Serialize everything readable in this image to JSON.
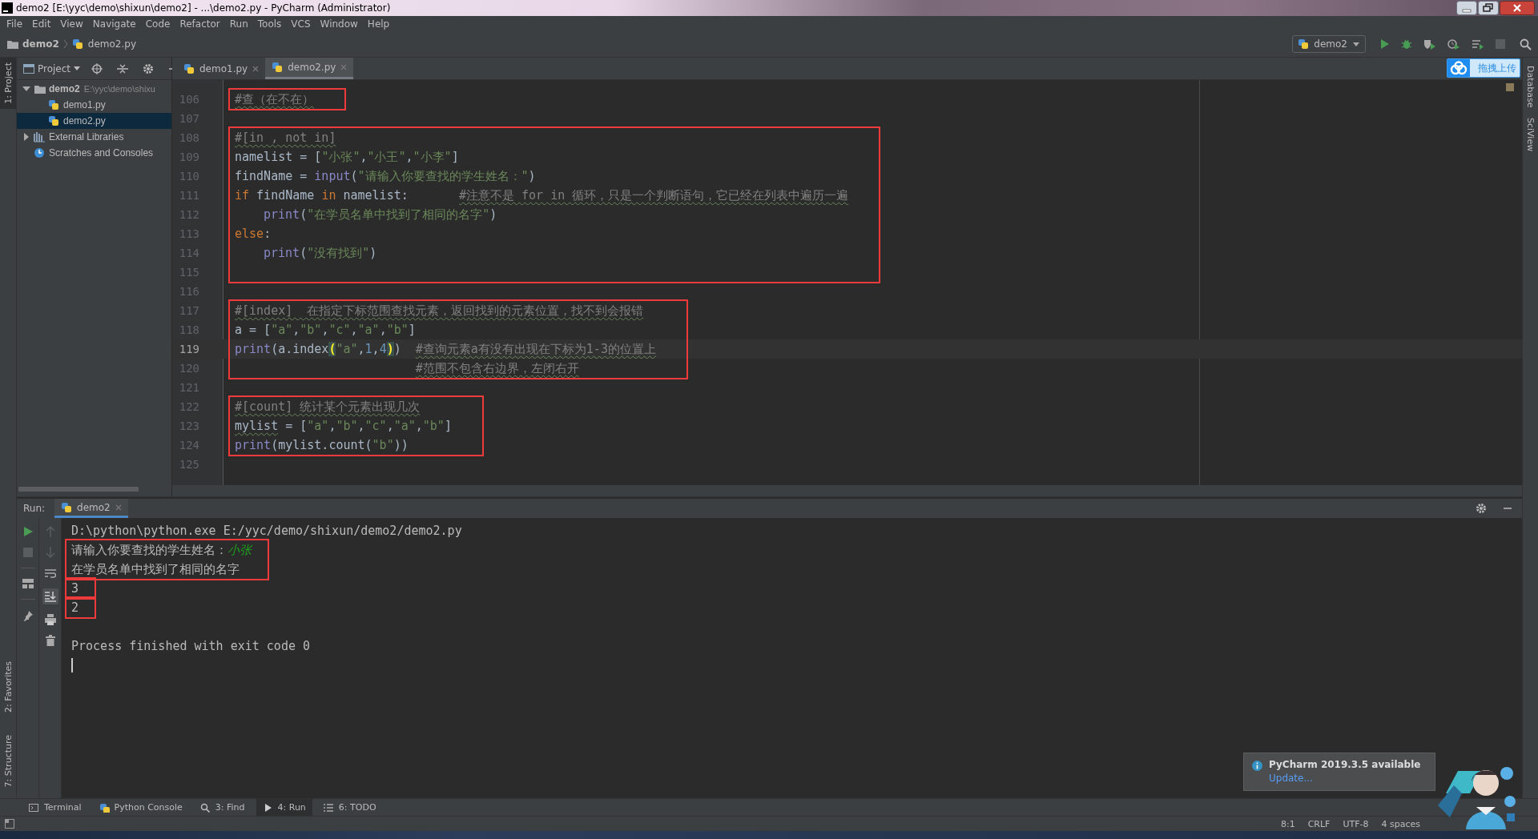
{
  "window": {
    "title": "demo2 [E:\\yyc\\demo\\shixun\\demo2] - ...\\demo2.py - PyCharm (Administrator)"
  },
  "menu": [
    "File",
    "Edit",
    "View",
    "Navigate",
    "Code",
    "Refactor",
    "Run",
    "Tools",
    "VCS",
    "Window",
    "Help"
  ],
  "breadcrumb": [
    "demo2",
    "demo2.py"
  ],
  "run_config": {
    "label": "demo2"
  },
  "upload_widget": {
    "label": "拖拽上传"
  },
  "left_stripe": {
    "top": [
      {
        "label": "1: Project",
        "selected": true
      }
    ],
    "bottom": [
      {
        "label": "2: Favorites",
        "selected": false
      },
      {
        "label": "7: Structure",
        "selected": false
      }
    ]
  },
  "right_stripe": [
    {
      "label": "Database"
    },
    {
      "label": "SciView"
    }
  ],
  "project_panel": {
    "title": "Project",
    "tree": [
      {
        "label": "demo2",
        "path": "E:\\yyc\\demo\\shixu",
        "kind": "folder",
        "expanded": true,
        "selected": false,
        "children": [
          {
            "label": "demo1.py",
            "kind": "python",
            "selected": false
          },
          {
            "label": "demo2.py",
            "kind": "python",
            "selected": true
          }
        ]
      },
      {
        "label": "External Libraries",
        "kind": "libraries",
        "expanded": false,
        "selected": false
      },
      {
        "label": "Scratches and Consoles",
        "kind": "scratches",
        "selected": false
      }
    ]
  },
  "editor_tabs": [
    {
      "label": "demo1.py",
      "selected": false
    },
    {
      "label": "demo2.py",
      "selected": true
    }
  ],
  "code_blocks": [
    {
      "highlighted": true,
      "lines": [
        {
          "number": "106",
          "current": false,
          "tokens": [
            {
              "kind": "comment",
              "text": "#查（在不在）"
            }
          ]
        }
      ]
    },
    {
      "highlighted": false,
      "lines": [
        {
          "number": "107",
          "current": false
        }
      ]
    },
    {
      "highlighted": true,
      "lines": [
        {
          "number": "108",
          "current": false,
          "tokens": [
            {
              "kind": "comment",
              "text": "#[in , not in]"
            }
          ]
        },
        {
          "number": "109",
          "current": false,
          "tokens": [
            {
              "kind": "plain",
              "text": "namelist = ["
            },
            {
              "kind": "string",
              "text": "\"小张\""
            },
            {
              "kind": "plain",
              "text": ","
            },
            {
              "kind": "string",
              "text": "\"小王\""
            },
            {
              "kind": "plain",
              "text": ","
            },
            {
              "kind": "string",
              "text": "\"小李\""
            },
            {
              "kind": "plain",
              "text": "]"
            }
          ]
        },
        {
          "number": "110",
          "current": false,
          "tokens": [
            {
              "kind": "plain",
              "text": "findName = "
            },
            {
              "kind": "builtin",
              "text": "input"
            },
            {
              "kind": "plain",
              "text": "("
            },
            {
              "kind": "string",
              "text": "\"请输入你要查找的学生姓名：\""
            },
            {
              "kind": "plain",
              "text": ")"
            }
          ]
        },
        {
          "number": "111",
          "current": false,
          "tokens": [
            {
              "kind": "keyword",
              "text": "if"
            },
            {
              "kind": "plain",
              "text": " findName "
            },
            {
              "kind": "keyword",
              "text": "in"
            },
            {
              "kind": "plain",
              "text": " namelist:       "
            },
            {
              "kind": "comment",
              "text": "#注意不是 for in 循环，只是一个判断语句，它已经在列表中遍历一遍"
            }
          ]
        },
        {
          "number": "112",
          "current": false,
          "kind": "indented",
          "tokens": [
            {
              "kind": "builtin",
              "text": "print"
            },
            {
              "kind": "plain",
              "text": "("
            },
            {
              "kind": "string",
              "text": "\"在学员名单中找到了相同的名字\""
            },
            {
              "kind": "plain",
              "text": ")"
            }
          ]
        },
        {
          "number": "113",
          "current": false,
          "tokens": [
            {
              "kind": "keyword",
              "text": "else"
            },
            {
              "kind": "plain",
              "text": ":"
            }
          ]
        },
        {
          "number": "114",
          "current": false,
          "kind": "indented",
          "tokens": [
            {
              "kind": "builtin",
              "text": "print"
            },
            {
              "kind": "plain",
              "text": "("
            },
            {
              "kind": "string",
              "text": "\"没有找到\""
            },
            {
              "kind": "plain",
              "text": ")"
            }
          ]
        },
        {
          "number": "115",
          "current": false
        }
      ]
    },
    {
      "highlighted": false,
      "lines": [
        {
          "number": "116",
          "current": false
        }
      ]
    },
    {
      "highlighted": true,
      "lines": [
        {
          "number": "117",
          "current": false,
          "tokens": [
            {
              "kind": "comment",
              "text": "#[index]  在指定下标范围查找元素，返回找到的元素位置，找不到会报错"
            }
          ]
        },
        {
          "number": "118",
          "current": false,
          "tokens": [
            {
              "kind": "plain",
              "text": "a = ["
            },
            {
              "kind": "string",
              "text": "\"a\""
            },
            {
              "kind": "plain",
              "text": ","
            },
            {
              "kind": "string",
              "text": "\"b\""
            },
            {
              "kind": "plain",
              "text": ","
            },
            {
              "kind": "string",
              "text": "\"c\""
            },
            {
              "kind": "plain",
              "text": ","
            },
            {
              "kind": "string",
              "text": "\"a\""
            },
            {
              "kind": "plain",
              "text": ","
            },
            {
              "kind": "string",
              "text": "\"b\""
            },
            {
              "kind": "plain",
              "text": "]"
            }
          ]
        },
        {
          "number": "119",
          "current": true,
          "tokens": [
            {
              "kind": "builtin",
              "text": "print"
            },
            {
              "kind": "plain",
              "text": "(a.index"
            },
            {
              "kind": "brace",
              "text": "("
            },
            {
              "kind": "string",
              "text": "\"a\""
            },
            {
              "kind": "plain",
              "text": ","
            },
            {
              "kind": "number",
              "text": "1"
            },
            {
              "kind": "plain",
              "text": ","
            },
            {
              "kind": "number",
              "text": "4"
            },
            {
              "kind": "brace",
              "text": ")"
            },
            {
              "kind": "plain",
              "text": ")  "
            },
            {
              "kind": "comment",
              "text": "#查询元素a有没有出现在下标为1-3的位置上"
            }
          ]
        },
        {
          "number": "120",
          "current": false,
          "kind": "aligned",
          "tokens": [
            {
              "kind": "comment",
              "text": "#范围不包含右边界，左闭右开"
            }
          ]
        }
      ]
    },
    {
      "highlighted": false,
      "lines": [
        {
          "number": "121",
          "current": false
        }
      ]
    },
    {
      "highlighted": true,
      "lines": [
        {
          "number": "122",
          "current": false,
          "tokens": [
            {
              "kind": "comment",
              "text": "#[count] 统计某个元素出现几次"
            }
          ]
        },
        {
          "number": "123",
          "current": false,
          "tokens": [
            {
              "kind": "typo",
              "text": "mylist"
            },
            {
              "kind": "plain",
              "text": " = ["
            },
            {
              "kind": "string",
              "text": "\"a\""
            },
            {
              "kind": "plain",
              "text": ","
            },
            {
              "kind": "string",
              "text": "\"b\""
            },
            {
              "kind": "plain",
              "text": ","
            },
            {
              "kind": "string",
              "text": "\"c\""
            },
            {
              "kind": "plain",
              "text": ","
            },
            {
              "kind": "string",
              "text": "\"a\""
            },
            {
              "kind": "plain",
              "text": ","
            },
            {
              "kind": "string",
              "text": "\"b\""
            },
            {
              "kind": "plain",
              "text": "]"
            }
          ]
        },
        {
          "number": "124",
          "current": false,
          "tokens": [
            {
              "kind": "builtin",
              "text": "print"
            },
            {
              "kind": "plain",
              "text": "(mylist.count("
            },
            {
              "kind": "string",
              "text": "\"b\""
            },
            {
              "kind": "plain",
              "text": "))"
            }
          ]
        }
      ]
    },
    {
      "highlighted": false,
      "lines": [
        {
          "number": "125",
          "current": false
        }
      ]
    }
  ],
  "run_panel": {
    "label": "Run:",
    "tabs": [
      {
        "label": "demo2",
        "selected": true
      }
    ],
    "output_blocks": [
      {
        "highlighted": false,
        "spaced": false,
        "lines": [
          [
            {
              "kind": "output",
              "text": "D:\\python\\python.exe E:/yyc/demo/shixun/demo2/demo2.py"
            }
          ]
        ]
      },
      {
        "highlighted": true,
        "spaced": false,
        "lines": [
          [
            {
              "kind": "output",
              "text": "请输入你要查找的学生姓名："
            },
            {
              "kind": "input",
              "text": "小张"
            }
          ],
          [
            {
              "kind": "output",
              "text": "在学员名单中找到了相同的名字"
            }
          ]
        ]
      },
      {
        "highlighted": true,
        "spaced": false,
        "lines": [
          [
            {
              "kind": "output",
              "text": "3"
            }
          ]
        ]
      },
      {
        "highlighted": true,
        "spaced": false,
        "lines": [
          [
            {
              "kind": "output",
              "text": "2"
            }
          ]
        ]
      },
      {
        "highlighted": false,
        "spaced": true,
        "lines": [
          [
            {
              "kind": "output",
              "text": "Process finished with exit code 0"
            }
          ]
        ]
      }
    ]
  },
  "tool_tabs": [
    {
      "label": "Terminal",
      "kind": "terminal",
      "selected": false
    },
    {
      "label": "Python Console",
      "kind": "python",
      "selected": false
    },
    {
      "label": "3: Find",
      "kind": "find",
      "selected": false
    },
    {
      "label": "4: Run",
      "kind": "run",
      "selected": true
    },
    {
      "label": "6: TODO",
      "kind": "todo",
      "selected": false
    }
  ],
  "notification": {
    "title": "PyCharm 2019.3.5 available",
    "link": "Update..."
  },
  "status_bar": [
    "8:1",
    "CRLF",
    "UTF-8",
    "4 spaces"
  ]
}
